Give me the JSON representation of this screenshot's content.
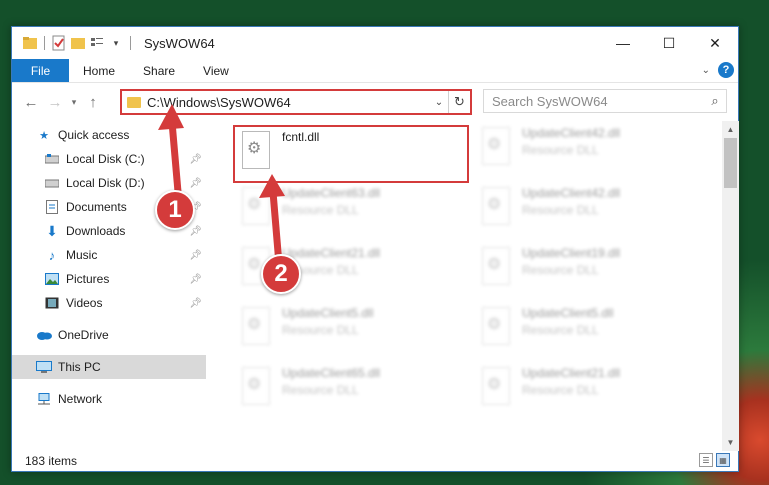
{
  "window": {
    "title": "SysWOW64",
    "controls": {
      "minimize": "—",
      "maximize": "☐",
      "close": "✕"
    }
  },
  "ribbon": {
    "tabs": [
      "File",
      "Home",
      "Share",
      "View"
    ]
  },
  "navbar": {
    "address": "C:\\Windows\\SysWOW64",
    "search_placeholder": "Search SysWOW64"
  },
  "sidebar": {
    "items": [
      {
        "label": "Quick access",
        "icon": "star-icon",
        "pinned": false
      },
      {
        "label": "Local Disk (C:)",
        "icon": "drive-icon",
        "pinned": true
      },
      {
        "label": "Local Disk (D:)",
        "icon": "drive-icon",
        "pinned": true
      },
      {
        "label": "Documents",
        "icon": "document-icon",
        "pinned": true
      },
      {
        "label": "Downloads",
        "icon": "download-icon",
        "pinned": true
      },
      {
        "label": "Music",
        "icon": "music-icon",
        "pinned": true
      },
      {
        "label": "Pictures",
        "icon": "pictures-icon",
        "pinned": true
      },
      {
        "label": "Videos",
        "icon": "videos-icon",
        "pinned": true
      },
      {
        "label": "OneDrive",
        "icon": "cloud-icon",
        "pinned": false
      },
      {
        "label": "This PC",
        "icon": "computer-icon",
        "pinned": false,
        "selected": true
      },
      {
        "label": "Network",
        "icon": "network-icon",
        "pinned": false
      }
    ]
  },
  "files": {
    "left_column": [
      {
        "name": "fcntl.dll",
        "type": "",
        "highlighted": true
      },
      {
        "name": "UpdateClient63.dll",
        "type": "Resource DLL"
      },
      {
        "name": "UpdateClient21.dll",
        "type": "Resource DLL"
      },
      {
        "name": "UpdateClient5.dll",
        "type": "Resource DLL"
      },
      {
        "name": "UpdateClient65.dll",
        "type": "Resource DLL"
      }
    ],
    "right_column": [
      {
        "name": "UpdateClient42.dll",
        "type": "Resource DLL"
      },
      {
        "name": "UpdateClient42.dll",
        "type": "Resource DLL"
      },
      {
        "name": "UpdateClient19.dll",
        "type": "Resource DLL"
      },
      {
        "name": "UpdateClient5.dll",
        "type": "Resource DLL"
      },
      {
        "name": "UpdateClient21.dll",
        "type": "Resource DLL"
      }
    ]
  },
  "statusbar": {
    "count": "183 items"
  },
  "callouts": {
    "step1": "1",
    "step2": "2"
  },
  "colors": {
    "accent": "#1979ca",
    "highlight": "#d43b3b",
    "selected_bg": "#d9d9d9"
  }
}
